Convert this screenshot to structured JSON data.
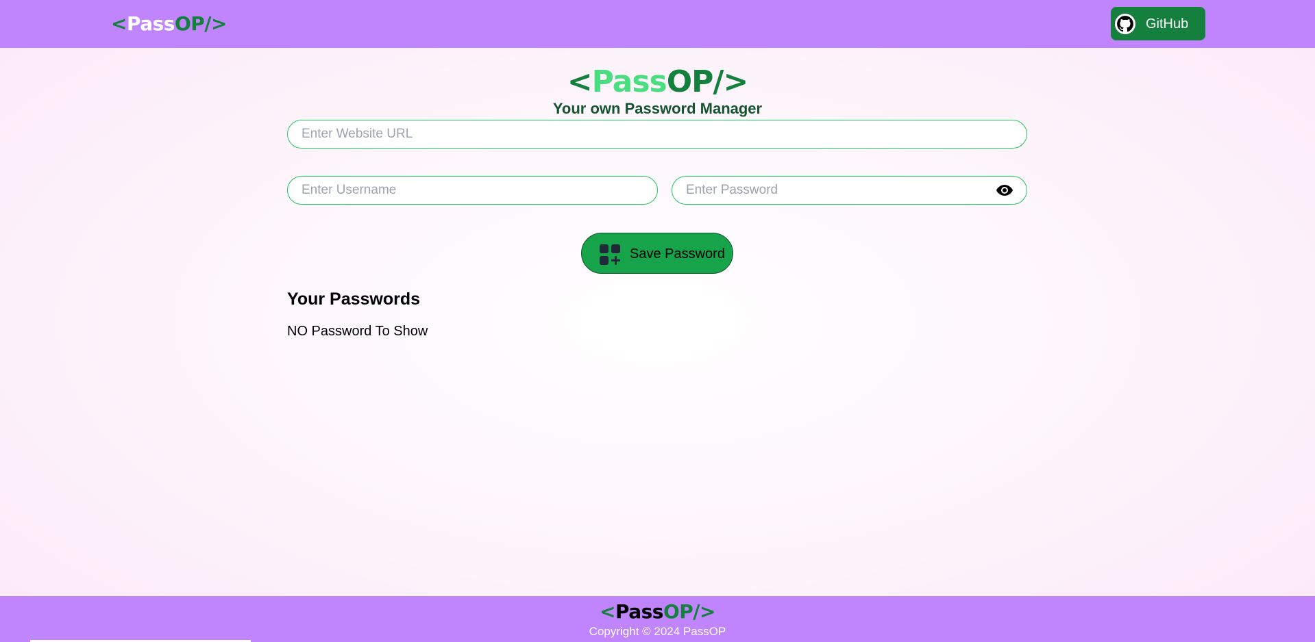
{
  "navbar": {
    "logo": {
      "lt": "<",
      "pass": "Pass",
      "op": "OP/",
      "gt": ">"
    },
    "github_label": "GitHub",
    "github_icon": "github-icon"
  },
  "hero": {
    "logo": {
      "lt": "<",
      "pass": "Pass",
      "op": "OP/",
      "gt": ">"
    },
    "tagline": "Your own Password Manager"
  },
  "form": {
    "url_placeholder": "Enter Website URL",
    "url_value": "",
    "username_placeholder": "Enter Username",
    "username_value": "",
    "password_placeholder": "Enter Password",
    "password_value": "",
    "eye_icon": "eye-icon",
    "save_label": "Save Password",
    "save_icon": "add-widget-icon"
  },
  "passwords": {
    "heading": "Your Passwords",
    "empty_text": "NO Password To Show"
  },
  "footer": {
    "logo": {
      "lt": "<",
      "pass": "Pass",
      "op": "OP/",
      "gt": ">"
    },
    "copyright": "Copyright © 2024 PassOP"
  },
  "colors": {
    "nav_bg": "#c084fc",
    "accent_green": "#15803d",
    "button_green": "#16a34a",
    "light_green": "#4ade80"
  }
}
